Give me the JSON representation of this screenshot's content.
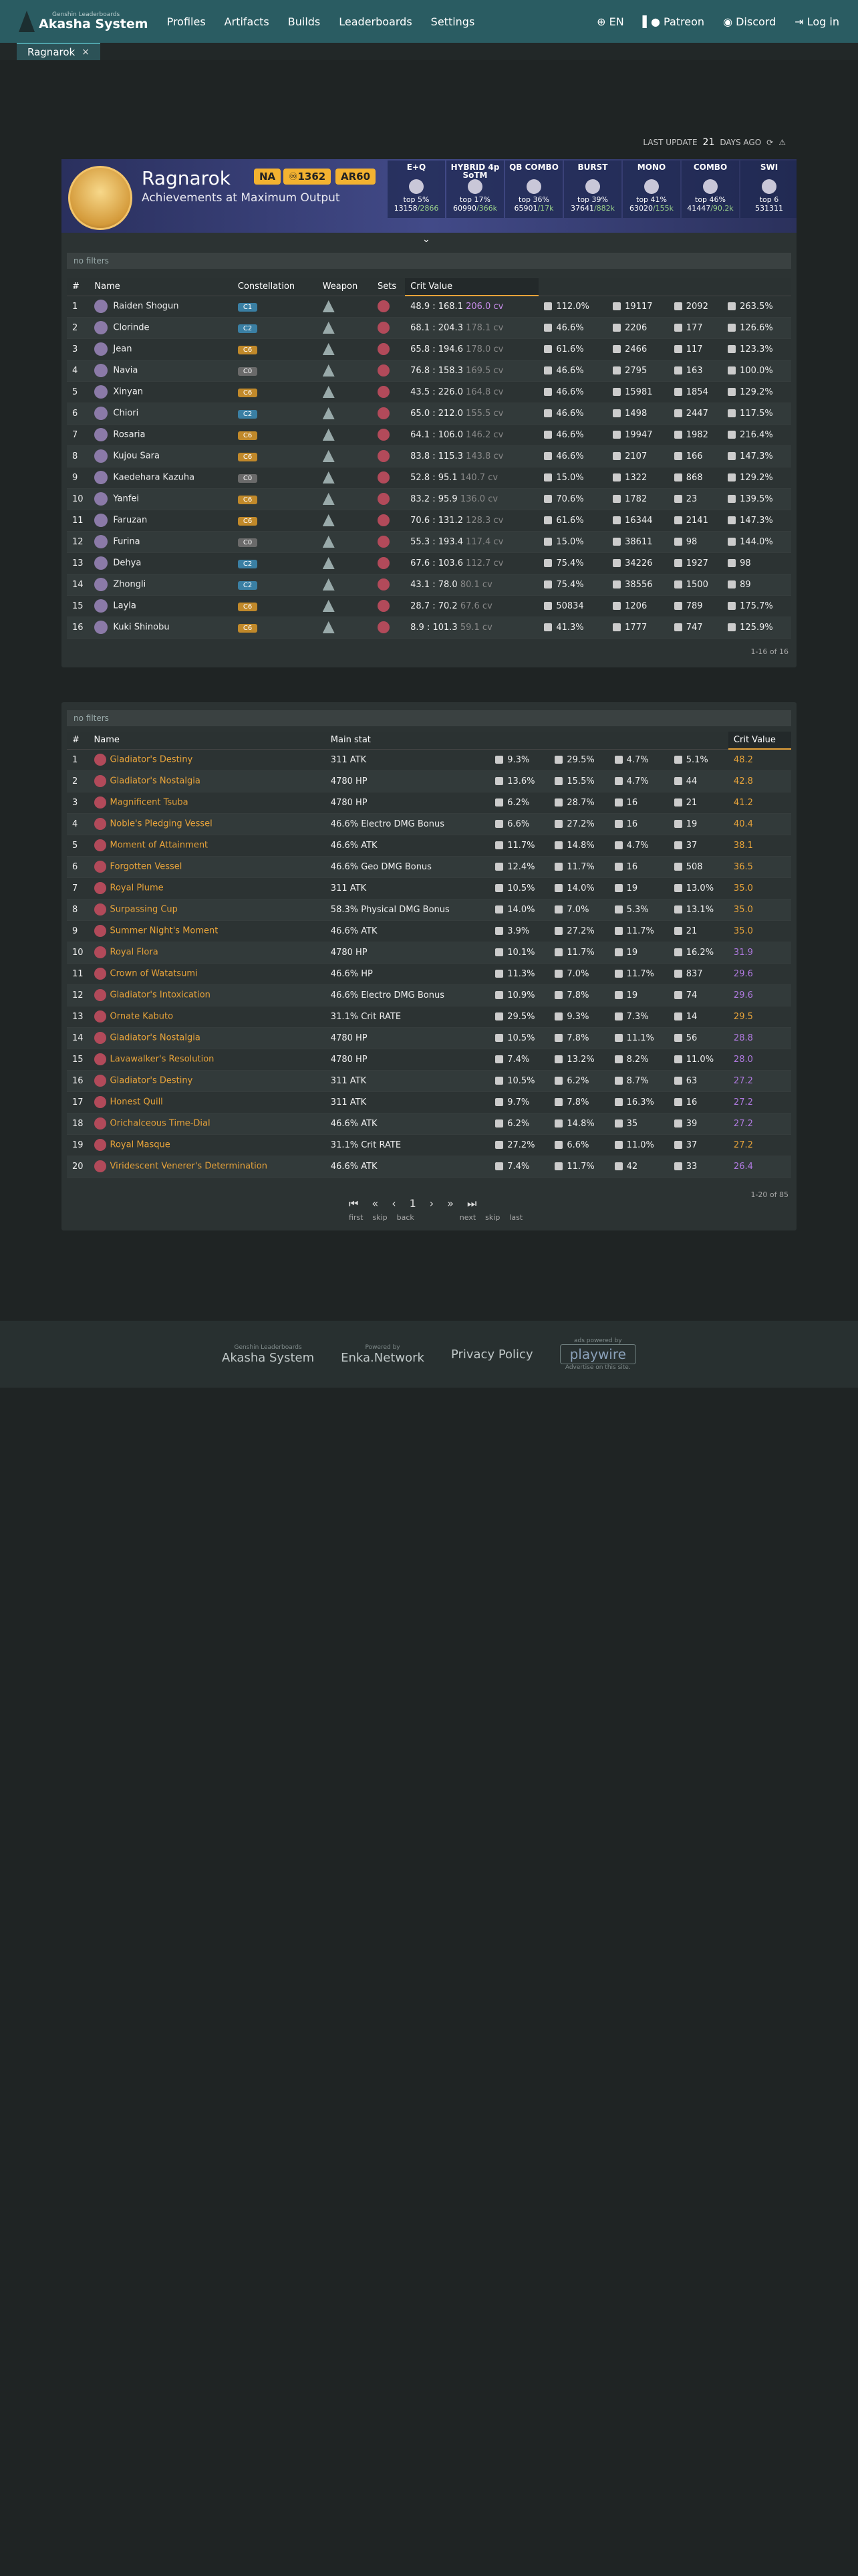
{
  "nav": {
    "brand_sub": "Genshin Leaderboards",
    "brand_name": "Akasha System",
    "links": [
      "Profiles",
      "Artifacts",
      "Builds",
      "Leaderboards",
      "Settings"
    ],
    "lang": "EN",
    "patreon": "Patreon",
    "discord": "Discord",
    "login": "Log in"
  },
  "tab": {
    "label": "Ragnarok",
    "close": "×"
  },
  "update": {
    "label": "LAST UPDATE",
    "value": "21",
    "suffix": "DAYS AGO"
  },
  "profile": {
    "name": "Ragnarok",
    "subtitle": "Achievements at Maximum Output",
    "region": "NA",
    "achievements": "1362",
    "ar": "AR60",
    "combos": [
      {
        "name": "E+Q",
        "rank": "top 5%",
        "val": "13158",
        "total": "/2866"
      },
      {
        "name": "HYBRID 4p SoTM",
        "rank": "top 17%",
        "val": "60990",
        "total": "/366k"
      },
      {
        "name": "QB COMBO",
        "rank": "top 36%",
        "val": "65901",
        "total": "/17k"
      },
      {
        "name": "BURST",
        "rank": "top 39%",
        "val": "37641",
        "total": "/882k"
      },
      {
        "name": "MONO",
        "rank": "top 41%",
        "val": "63020",
        "total": "/155k"
      },
      {
        "name": "COMBO",
        "rank": "top 46%",
        "val": "41447",
        "total": "/90.2k"
      },
      {
        "name": "SWI",
        "rank": "top 6",
        "val": "531311",
        "total": ""
      }
    ]
  },
  "builds": {
    "filter": "no filters",
    "headers": [
      "#",
      "Name",
      "Constellation",
      "Weapon",
      "Sets",
      "Crit Value"
    ],
    "pager": "1-16 of 16",
    "rows": [
      {
        "n": "1",
        "name": "Raiden Shogun",
        "c": "C1",
        "cv": "48.9 : 168.1",
        "cvv": "206.0 cv",
        "s1": "112.0%",
        "s2": "19117",
        "s3": "2092",
        "s4": "263.5%"
      },
      {
        "n": "2",
        "name": "Clorinde",
        "c": "C2",
        "cv": "68.1 : 204.3",
        "cvv": "178.1 cv",
        "s1": "46.6%",
        "s2": "2206",
        "s3": "177",
        "s4": "126.6%"
      },
      {
        "n": "3",
        "name": "Jean",
        "c": "C6",
        "cv": "65.8 : 194.6",
        "cvv": "178.0 cv",
        "s1": "61.6%",
        "s2": "2466",
        "s3": "117",
        "s4": "123.3%"
      },
      {
        "n": "4",
        "name": "Navia",
        "c": "C0",
        "cv": "76.8 : 158.3",
        "cvv": "169.5 cv",
        "s1": "46.6%",
        "s2": "2795",
        "s3": "163",
        "s4": "100.0%"
      },
      {
        "n": "5",
        "name": "Xinyan",
        "c": "C6",
        "cv": "43.5 : 226.0",
        "cvv": "164.8 cv",
        "s1": "46.6%",
        "s2": "15981",
        "s3": "1854",
        "s4": "129.2%"
      },
      {
        "n": "6",
        "name": "Chiori",
        "c": "C2",
        "cv": "65.0 : 212.0",
        "cvv": "155.5 cv",
        "s1": "46.6%",
        "s2": "1498",
        "s3": "2447",
        "s4": "117.5%"
      },
      {
        "n": "7",
        "name": "Rosaria",
        "c": "C6",
        "cv": "64.1 : 106.0",
        "cvv": "146.2 cv",
        "s1": "46.6%",
        "s2": "19947",
        "s3": "1982",
        "s4": "216.4%"
      },
      {
        "n": "8",
        "name": "Kujou Sara",
        "c": "C6",
        "cv": "83.8 : 115.3",
        "cvv": "143.8 cv",
        "s1": "46.6%",
        "s2": "2107",
        "s3": "166",
        "s4": "147.3%"
      },
      {
        "n": "9",
        "name": "Kaedehara Kazuha",
        "c": "C0",
        "cv": "52.8 : 95.1",
        "cvv": "140.7 cv",
        "s1": "15.0%",
        "s2": "1322",
        "s3": "868",
        "s4": "129.2%"
      },
      {
        "n": "10",
        "name": "Yanfei",
        "c": "C6",
        "cv": "83.2 : 95.9",
        "cvv": "136.0 cv",
        "s1": "70.6%",
        "s2": "1782",
        "s3": "23",
        "s4": "139.5%"
      },
      {
        "n": "11",
        "name": "Faruzan",
        "c": "C6",
        "cv": "70.6 : 131.2",
        "cvv": "128.3 cv",
        "s1": "61.6%",
        "s2": "16344",
        "s3": "2141",
        "s4": "147.3%"
      },
      {
        "n": "12",
        "name": "Furina",
        "c": "C0",
        "cv": "55.3 : 193.4",
        "cvv": "117.4 cv",
        "s1": "15.0%",
        "s2": "38611",
        "s3": "98",
        "s4": "144.0%"
      },
      {
        "n": "13",
        "name": "Dehya",
        "c": "C2",
        "cv": "67.6 : 103.6",
        "cvv": "112.7 cv",
        "s1": "75.4%",
        "s2": "34226",
        "s3": "1927",
        "s4": "98"
      },
      {
        "n": "14",
        "name": "Zhongli",
        "c": "C2",
        "cv": "43.1 : 78.0",
        "cvv": "80.1 cv",
        "s1": "75.4%",
        "s2": "38556",
        "s3": "1500",
        "s4": "89"
      },
      {
        "n": "15",
        "name": "Layla",
        "c": "C6",
        "cv": "28.7 : 70.2",
        "cvv": "67.6 cv",
        "s1": "50834",
        "s2": "1206",
        "s3": "789",
        "s4": "175.7%"
      },
      {
        "n": "16",
        "name": "Kuki Shinobu",
        "c": "C6",
        "cv": "8.9 : 101.3",
        "cvv": "59.1 cv",
        "s1": "41.3%",
        "s2": "1777",
        "s3": "747",
        "s4": "125.9%"
      }
    ]
  },
  "artifacts": {
    "filter": "no filters",
    "headers": [
      "#",
      "Name",
      "Main stat",
      "Crit Value"
    ],
    "pager": "1-20 of 85",
    "pag_labels": [
      "first",
      "skip",
      "back",
      "1",
      "next",
      "skip",
      "last"
    ],
    "rows": [
      {
        "n": "1",
        "name": "Gladiator's Destiny",
        "main": "311 ATK",
        "a": "9.3%",
        "b": "29.5%",
        "c": "4.7%",
        "d": "5.1%",
        "cv": "48.2",
        "col": "#e7a33a"
      },
      {
        "n": "2",
        "name": "Gladiator's Nostalgia",
        "main": "4780 HP",
        "a": "13.6%",
        "b": "15.5%",
        "c": "4.7%",
        "d": "44",
        "cv": "42.8",
        "col": "#e7a33a"
      },
      {
        "n": "3",
        "name": "Magnificent Tsuba",
        "main": "4780 HP",
        "a": "6.2%",
        "b": "28.7%",
        "c": "16",
        "d": "21",
        "cv": "41.2",
        "col": "#e7a33a"
      },
      {
        "n": "4",
        "name": "Noble's Pledging Vessel",
        "main": "46.6% Electro DMG Bonus",
        "a": "6.6%",
        "b": "27.2%",
        "c": "16",
        "d": "19",
        "cv": "40.4",
        "col": "#e7a33a"
      },
      {
        "n": "5",
        "name": "Moment of Attainment",
        "main": "46.6% ATK",
        "a": "11.7%",
        "b": "14.8%",
        "c": "4.7%",
        "d": "37",
        "cv": "38.1",
        "col": "#e7a33a"
      },
      {
        "n": "6",
        "name": "Forgotten Vessel",
        "main": "46.6% Geo DMG Bonus",
        "a": "12.4%",
        "b": "11.7%",
        "c": "16",
        "d": "508",
        "cv": "36.5",
        "col": "#e7a33a"
      },
      {
        "n": "7",
        "name": "Royal Plume",
        "main": "311 ATK",
        "a": "10.5%",
        "b": "14.0%",
        "c": "19",
        "d": "13.0%",
        "cv": "35.0",
        "col": "#e7a33a"
      },
      {
        "n": "8",
        "name": "Surpassing Cup",
        "main": "58.3% Physical DMG Bonus",
        "a": "14.0%",
        "b": "7.0%",
        "c": "5.3%",
        "d": "13.1%",
        "cv": "35.0",
        "col": "#e7a33a"
      },
      {
        "n": "9",
        "name": "Summer Night's Moment",
        "main": "46.6% ATK",
        "a": "3.9%",
        "b": "27.2%",
        "c": "11.7%",
        "d": "21",
        "cv": "35.0",
        "col": "#e7a33a"
      },
      {
        "n": "10",
        "name": "Royal Flora",
        "main": "4780 HP",
        "a": "10.1%",
        "b": "11.7%",
        "c": "19",
        "d": "16.2%",
        "cv": "31.9",
        "col": "#b07ae0"
      },
      {
        "n": "11",
        "name": "Crown of Watatsumi",
        "main": "46.6% HP",
        "a": "11.3%",
        "b": "7.0%",
        "c": "11.7%",
        "d": "837",
        "cv": "29.6",
        "col": "#b07ae0"
      },
      {
        "n": "12",
        "name": "Gladiator's Intoxication",
        "main": "46.6% Electro DMG Bonus",
        "a": "10.9%",
        "b": "7.8%",
        "c": "19",
        "d": "74",
        "cv": "29.6",
        "col": "#b07ae0"
      },
      {
        "n": "13",
        "name": "Ornate Kabuto",
        "main": "31.1% Crit RATE",
        "a": "29.5%",
        "b": "9.3%",
        "c": "7.3%",
        "d": "14",
        "cv": "29.5",
        "col": "#e7a33a"
      },
      {
        "n": "14",
        "name": "Gladiator's Nostalgia",
        "main": "4780 HP",
        "a": "10.5%",
        "b": "7.8%",
        "c": "11.1%",
        "d": "56",
        "cv": "28.8",
        "col": "#b07ae0"
      },
      {
        "n": "15",
        "name": "Lavawalker's Resolution",
        "main": "4780 HP",
        "a": "7.4%",
        "b": "13.2%",
        "c": "8.2%",
        "d": "11.0%",
        "cv": "28.0",
        "col": "#b07ae0"
      },
      {
        "n": "16",
        "name": "Gladiator's Destiny",
        "main": "311 ATK",
        "a": "10.5%",
        "b": "6.2%",
        "c": "8.7%",
        "d": "63",
        "cv": "27.2",
        "col": "#b07ae0"
      },
      {
        "n": "17",
        "name": "Honest Quill",
        "main": "311 ATK",
        "a": "9.7%",
        "b": "7.8%",
        "c": "16.3%",
        "d": "16",
        "cv": "27.2",
        "col": "#b07ae0"
      },
      {
        "n": "18",
        "name": "Orichalceous Time-Dial",
        "main": "46.6% ATK",
        "a": "6.2%",
        "b": "14.8%",
        "c": "35",
        "d": "39",
        "cv": "27.2",
        "col": "#b07ae0"
      },
      {
        "n": "19",
        "name": "Royal Masque",
        "main": "31.1% Crit RATE",
        "a": "27.2%",
        "b": "6.6%",
        "c": "11.0%",
        "d": "37",
        "cv": "27.2",
        "col": "#e7a33a"
      },
      {
        "n": "20",
        "name": "Viridescent Venerer's Determination",
        "main": "46.6% ATK",
        "a": "7.4%",
        "b": "11.7%",
        "c": "42",
        "d": "33",
        "cv": "26.4",
        "col": "#b07ae0"
      }
    ]
  },
  "footer": {
    "brand_sub": "Genshin Leaderboards",
    "brand": "Akasha System",
    "enka_sub": "Powered by",
    "enka": "Enka.Network",
    "privacy": "Privacy Policy",
    "ads_sub": "ads powered by",
    "ads": "playwire",
    "advertise": "Advertise on this site."
  }
}
